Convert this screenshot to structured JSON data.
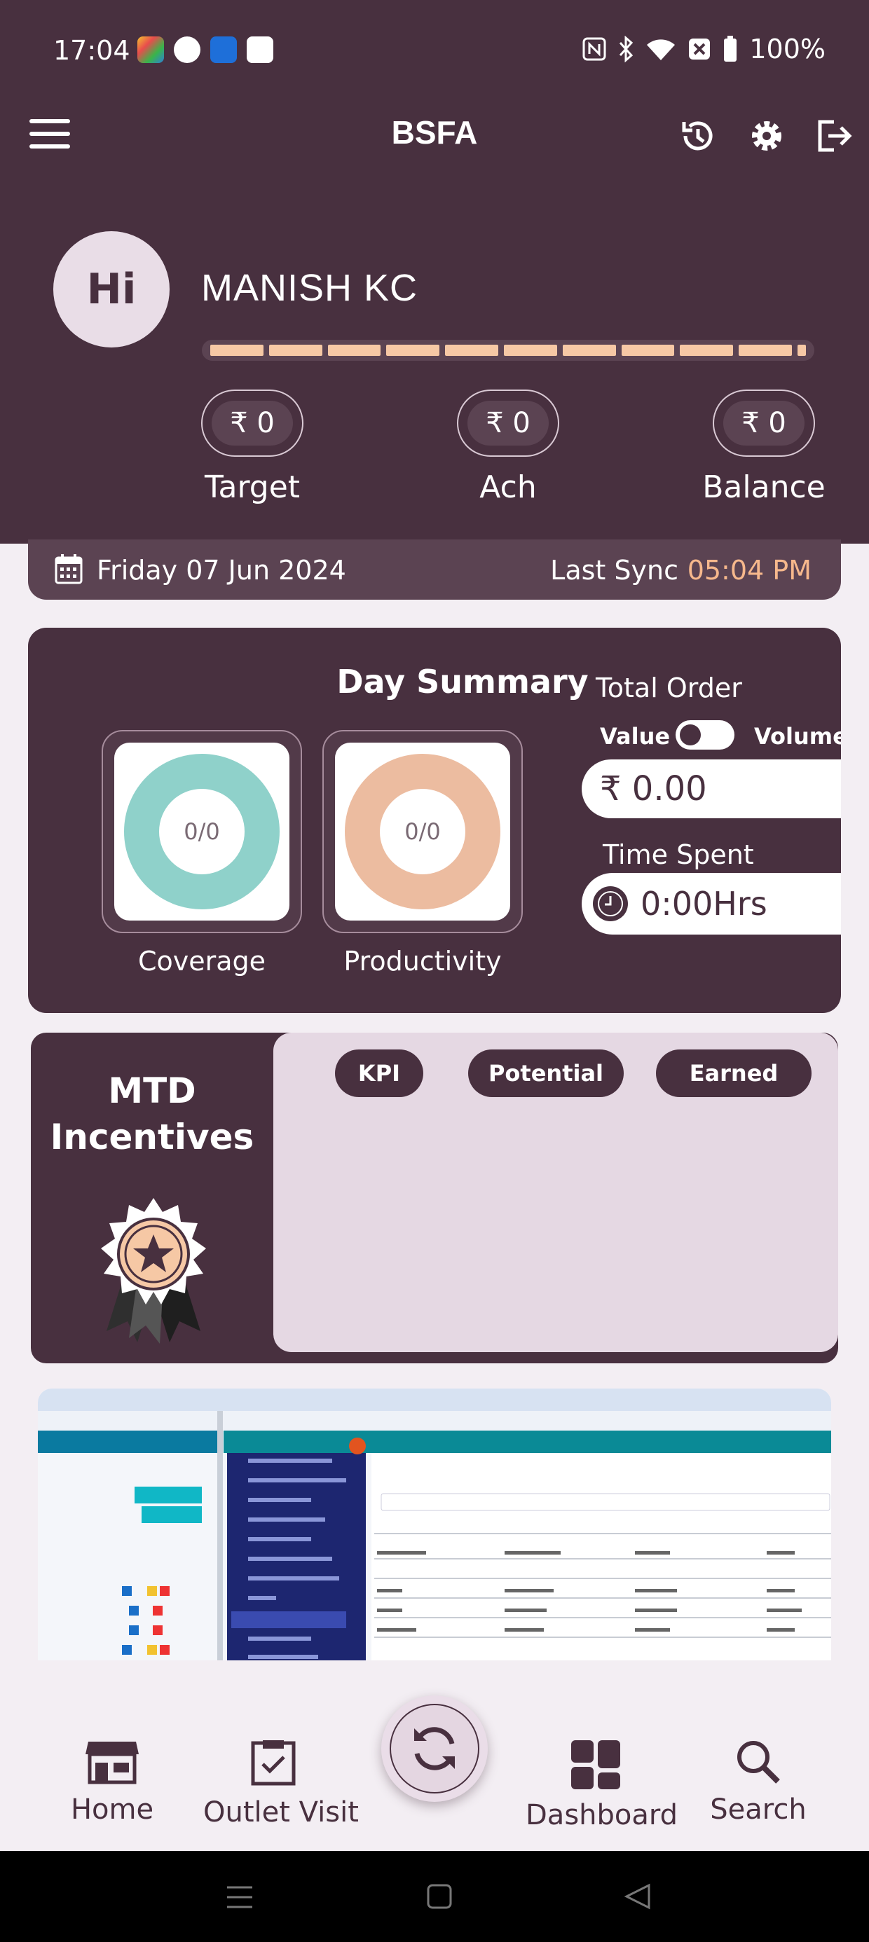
{
  "status_bar": {
    "time": "17:04",
    "battery": "100%"
  },
  "app_bar": {
    "title": "BSFA",
    "icons": [
      "menu-icon",
      "history-icon",
      "gear-icon",
      "logout-icon"
    ]
  },
  "profile": {
    "greeting": "Hi",
    "name": "MANISH KC",
    "progress_segments": 10,
    "stats": [
      {
        "value": "₹ 0",
        "label": "Target"
      },
      {
        "value": "₹ 0",
        "label": "Ach"
      },
      {
        "value": "₹ 0",
        "label": "Balance"
      }
    ]
  },
  "date_bar": {
    "date": "Friday 07 Jun 2024",
    "sync_label": "Last Sync",
    "sync_time": "05:04 PM"
  },
  "day_summary": {
    "title": "Day Summary",
    "coverage": {
      "value": "0/0",
      "label": "Coverage",
      "color": "#8fd1ca"
    },
    "productivity": {
      "value": "0/0",
      "label": "Productivity",
      "color": "#ecbca0"
    },
    "total_order_title": "Total Order",
    "toggle_left": "Value",
    "toggle_right": "Volume",
    "order_value": "₹ 0.00",
    "time_spent_title": "Time Spent",
    "time_spent_value": "0:00Hrs"
  },
  "mtd": {
    "title_line1": "MTD",
    "title_line2": "Incentives",
    "tabs": [
      "KPI",
      "Potential",
      "Earned"
    ]
  },
  "bottom_nav": {
    "home": "Home",
    "outlet_visit": "Outlet Visit",
    "dashboard": "Dashboard",
    "search": "Search"
  },
  "colors": {
    "primary": "#48303f",
    "accent": "#f6b88c",
    "surface": "#e5d8e3"
  }
}
